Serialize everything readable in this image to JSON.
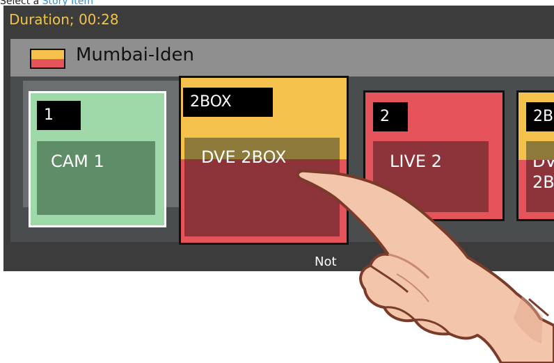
{
  "caption": {
    "prefix": "Select a ",
    "link": "Story Item"
  },
  "duration": {
    "text": "Duration; 00:28"
  },
  "story": {
    "title": "Mumbai-Iden",
    "flag_colors": [
      "#f4c14c",
      "#e4545a"
    ]
  },
  "cards": [
    {
      "number": "1",
      "label": "CAM 1",
      "color": "#9fd9a9"
    },
    {
      "number": "2BOX",
      "label": "DVE 2BOX",
      "color": "#f4c14c"
    },
    {
      "number": "2",
      "label": "LIVE 2",
      "color": "#e4545a"
    },
    {
      "number": "2B",
      "label_line1": "DV",
      "label_line2": "2B",
      "color": "#f4c14c"
    }
  ],
  "footer": {
    "text": "Not"
  }
}
